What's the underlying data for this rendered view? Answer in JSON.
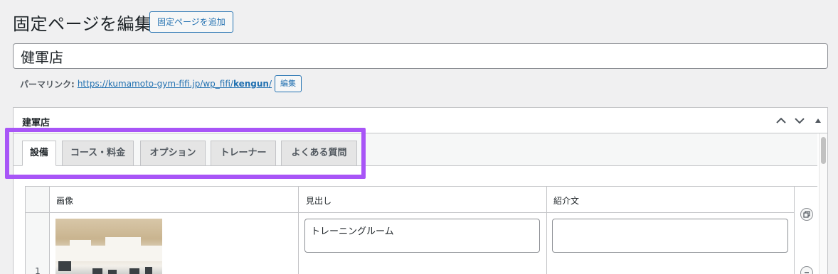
{
  "header": {
    "page_title": "固定ページを編集",
    "add_button": "固定ページを追加"
  },
  "post": {
    "title": "健軍店"
  },
  "permalink": {
    "label": "パーマリンク:",
    "url_prefix": "https://kumamoto-gym-fifi.jp/wp_fifi/",
    "slug": "kengun",
    "url_suffix": "/",
    "edit_button": "編集"
  },
  "metabox": {
    "title": "建軍店",
    "tabs": [
      {
        "label": "設備",
        "active": true
      },
      {
        "label": "コース・料金",
        "active": false
      },
      {
        "label": "オプション",
        "active": false
      },
      {
        "label": "トレーナー",
        "active": false
      },
      {
        "label": "よくある質問",
        "active": false
      }
    ],
    "table": {
      "columns": [
        "画像",
        "見出し",
        "紹介文"
      ],
      "rows": [
        {
          "num": "1",
          "heading": "トレーニングルーム",
          "intro": ""
        }
      ]
    }
  },
  "colors": {
    "accent": "#2271b1",
    "highlight": "#a855f7"
  }
}
